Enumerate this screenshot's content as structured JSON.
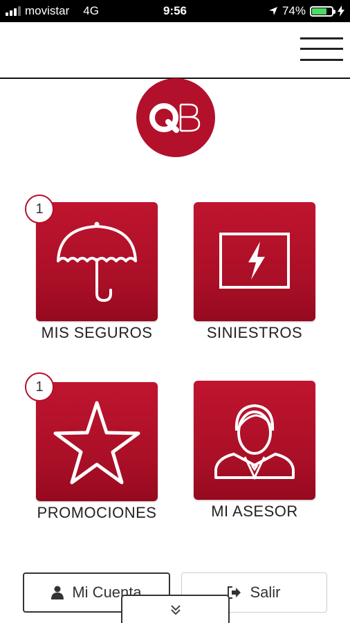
{
  "status_bar": {
    "carrier": "movistar",
    "network": "4G",
    "time": "9:56",
    "battery": "74%",
    "battery_level": 0.74
  },
  "logo": {
    "text": "QB"
  },
  "tiles": [
    {
      "label": "MIS SEGUROS",
      "badge": "1",
      "icon": "umbrella-icon"
    },
    {
      "label": "SINIESTROS",
      "icon": "lightning-frame-icon"
    },
    {
      "label": "PROMOCIONES",
      "badge": "1",
      "icon": "star-icon"
    },
    {
      "label": "MI ASESOR",
      "icon": "advisor-icon"
    }
  ],
  "buttons": {
    "mi_cuenta": "Mi Cuenta",
    "salir": "Salir"
  },
  "colors": {
    "primary": "#b3102b",
    "text": "#222222",
    "battery": "#4cd964"
  },
  "icons": [
    "signal-icon",
    "location-arrow-icon",
    "battery-icon",
    "charging-bolt-icon",
    "hamburger-menu-icon",
    "user-icon",
    "logout-icon",
    "double-chevron-down-icon"
  ]
}
